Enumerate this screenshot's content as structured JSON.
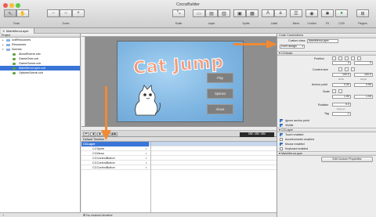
{
  "window": {
    "title": "CocosBuilder"
  },
  "toolbar": {
    "labels": {
      "tools": "Tools",
      "zoom": "Zoom",
      "scale": "Scale",
      "layer": "Layer",
      "sprite": "Sprite",
      "label": "Label",
      "menu": "Menu",
      "control": "Control",
      "fx": "FX",
      "ccb": "CCB",
      "plugins": "Plugins"
    }
  },
  "document": {
    "tab_label": "MainMenuLayer"
  },
  "project": {
    "header": "Project",
    "items": [
      {
        "label": "ccbResources",
        "kind": "folder",
        "indent": 0
      },
      {
        "label": "Resources",
        "kind": "folder",
        "indent": 0
      },
      {
        "label": "Scenes",
        "kind": "folder",
        "indent": 0
      },
      {
        "label": "AboutScene.ccb",
        "kind": "ccb",
        "indent": 1
      },
      {
        "label": "GameOver.ccb",
        "kind": "ccb",
        "indent": 1
      },
      {
        "label": "GameScene.ccb",
        "kind": "ccb",
        "indent": 1
      },
      {
        "label": "MainMenuLayer.ccb",
        "kind": "ccb",
        "indent": 1,
        "selected": true
      },
      {
        "label": "OptionsScene.ccb",
        "kind": "ccb",
        "indent": 1
      }
    ]
  },
  "stage": {
    "logo_text": "Cat Jump",
    "buttons": [
      "Play",
      "Options",
      "About"
    ]
  },
  "timeline": {
    "time": "00:00:00",
    "sequence_name": "Default Timeline",
    "rows": [
      {
        "label": "CCLayer",
        "selected": true
      },
      {
        "label": "CCSprite"
      },
      {
        "label": "CCMenu"
      },
      {
        "label": "CCControlButton"
      },
      {
        "label": "CCControlButton"
      },
      {
        "label": "CCControlButton"
      }
    ],
    "footer": "No chained timeline"
  },
  "inspector": {
    "code_connections_title": "Code Connections",
    "custom_class_label": "Custom class",
    "custom_class_value": "MainMenuLayer",
    "assign_value": "Don't assign",
    "ccnode_title": "CCNode",
    "position_label": "Position",
    "position_x": "0",
    "position_y": "0",
    "position_x_sub": "X",
    "position_y_sub": "Y",
    "content_size_label": "Content size",
    "content_w": "100.0",
    "content_h": "100.0",
    "content_w_sub": "Width",
    "content_h_sub": "Height",
    "anchor_label": "Anchor point",
    "anchor_x": "0.50",
    "anchor_y": "0.50",
    "scale_label": "Scale",
    "scale_x": "1.00",
    "scale_y": "1.00",
    "rotation_label": "Rotation",
    "rotation_value": "0.0",
    "rotation_sub": "Degrees",
    "tag_label": "Tag",
    "tag_value": "-1",
    "ignore_anchor": "Ignore anchor point",
    "visible": "Visible",
    "cclayer_title": "CCLayer",
    "touch_enabled": "Touch enabled",
    "accelerometer_enabled": "Accelerometer enabled",
    "mouse_enabled": "Mouse enabled",
    "keyboard_enabled": "Keyboard enabled",
    "mainmenu_title": "MainMenuLayer",
    "edit_custom": "Edit Custom Properties"
  },
  "colors": {
    "accent_arrow": "#f08a35",
    "selection": "#3875d7",
    "scene_sky": "#7fb6e2",
    "logo": "#f29b7a"
  }
}
